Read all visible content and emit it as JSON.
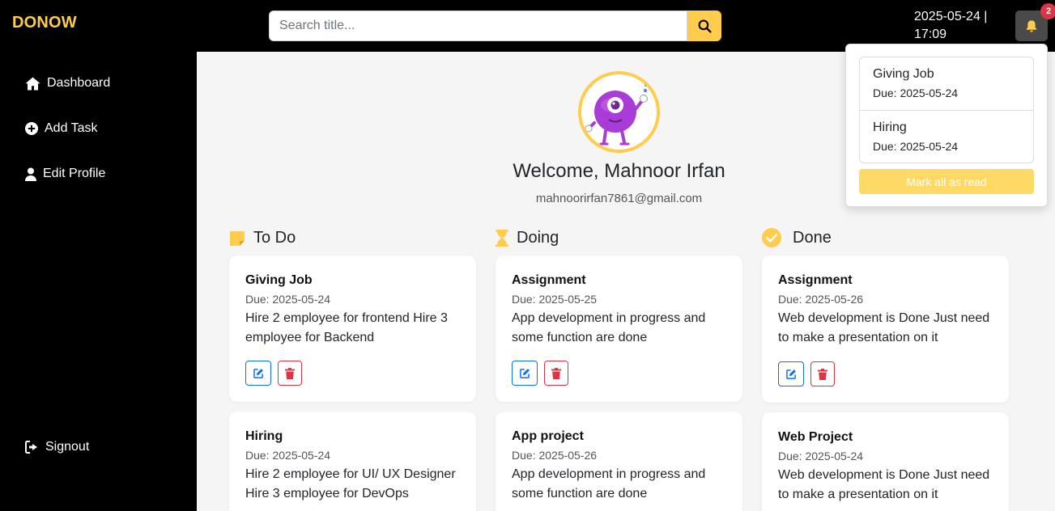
{
  "app": {
    "brand": "DONOW"
  },
  "search": {
    "placeholder": "Search title..."
  },
  "header": {
    "datetime": "2025-05-24 | 17:09",
    "notification_count": "2"
  },
  "sidebar": {
    "items": [
      {
        "label": "Dashboard",
        "icon": "home-icon"
      },
      {
        "label": "Add Task",
        "icon": "plus-circle-icon"
      },
      {
        "label": "Edit Profile",
        "icon": "user-icon"
      }
    ],
    "signout": {
      "label": "Signout",
      "icon": "signout-icon"
    }
  },
  "profile": {
    "welcome": "Welcome, Mahnoor Irfan",
    "email": "mahnoorirfan7861@gmail.com"
  },
  "columns": [
    {
      "title": "To Do",
      "icon": "sticky-note-icon",
      "cards": [
        {
          "title": "Giving Job",
          "due": "Due: 2025-05-24",
          "desc": "Hire 2 employee for frontend Hire 3 employee for Backend"
        },
        {
          "title": "Hiring",
          "due": "Due: 2025-05-24",
          "desc": "Hire 2 employee for UI/ UX Designer Hire 3 employee for DevOps"
        }
      ]
    },
    {
      "title": "Doing",
      "icon": "hourglass-icon",
      "cards": [
        {
          "title": "Assignment",
          "due": "Due: 2025-05-25",
          "desc": "App development in progress and some function are done"
        },
        {
          "title": "App project",
          "due": "Due: 2025-05-26",
          "desc": "App development in progress and some function are done"
        }
      ]
    },
    {
      "title": "Done",
      "icon": "check-circle-icon",
      "cards": [
        {
          "title": "Assignment",
          "due": "Due: 2025-05-26",
          "desc": "Web development is Done Just need to make a presentation on it"
        },
        {
          "title": "Web Project",
          "due": "Due: 2025-05-24",
          "desc": "Web development is Done Just need to make a presentation on it"
        }
      ]
    }
  ],
  "notifications": {
    "items": [
      {
        "title": "Giving Job",
        "due": "Due: 2025-05-24"
      },
      {
        "title": "Hiring",
        "due": "Due: 2025-05-24"
      }
    ],
    "mark_all_label": "Mark all as read"
  },
  "colors": {
    "accent": "#ffcc4d",
    "edit": "#0d6efd",
    "delete": "#dc3545",
    "sidebar": "#000000",
    "main_bg": "#f5f5f5"
  }
}
